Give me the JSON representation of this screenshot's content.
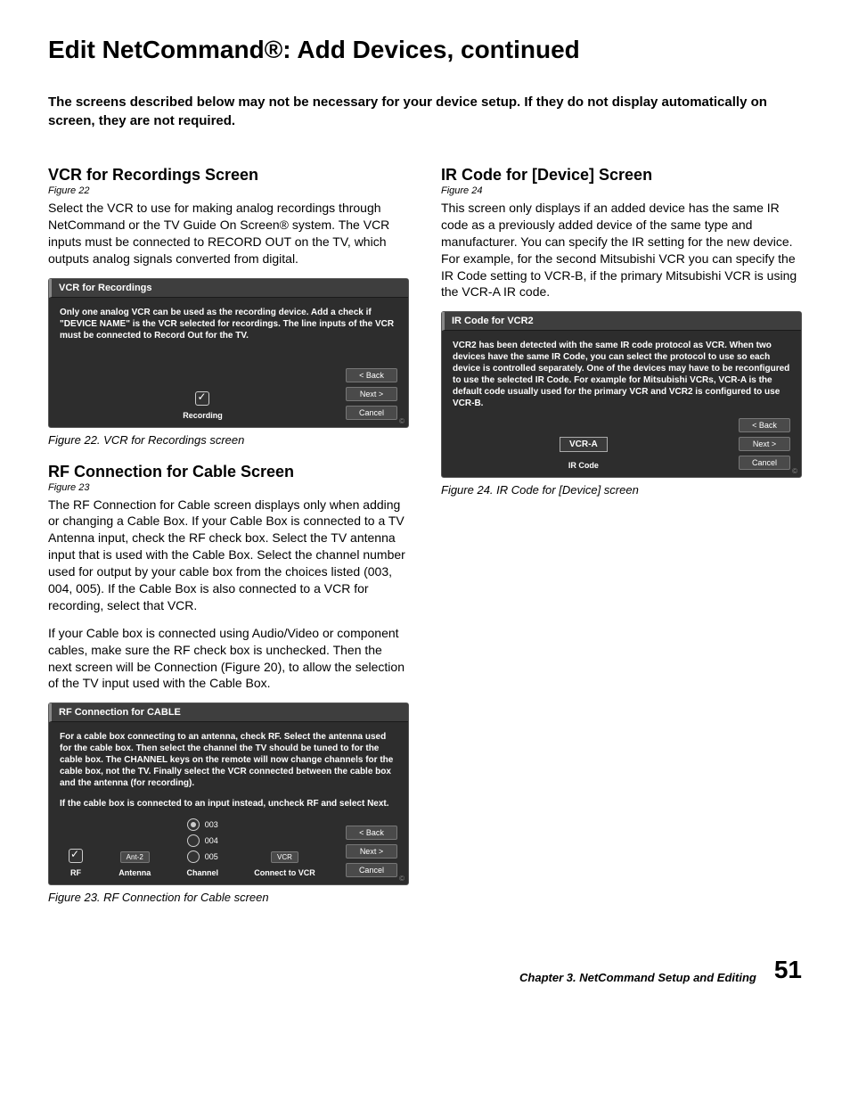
{
  "page_title": "Edit NetCommand®:  Add Devices, continued",
  "note": "The screens described below may not be necessary for your device setup.  If they do not display automatically on screen, they are not required.",
  "left": {
    "vcr": {
      "heading": "VCR for Recordings Screen",
      "figref": "Figure 22",
      "body": "Select the VCR to use for making analog recordings through NetCommand or the TV Guide On Screen® system.  The VCR inputs must be connected to RECORD OUT on the TV, which outputs analog signals converted from digital.",
      "dialog_title": "VCR for Recordings",
      "dialog_text": "Only one analog VCR can be used as the recording device.  Add a check if \"DEVICE NAME\" is the VCR selected for recordings.  The line inputs of the VCR must be connected to Record Out for the TV.",
      "recording_label": "Recording",
      "caption": "Figure 22. VCR for Recordings screen"
    },
    "rf": {
      "heading": "RF Connection for Cable Screen",
      "figref": "Figure 23",
      "body1": "The RF Connection for Cable screen displays only when adding or changing a Cable Box.  If your Cable Box is connected to a TV Antenna input, check the RF check box.  Select the TV antenna input that is used with the Cable Box.  Select the channel number used for output by your cable box from the choices listed (003, 004, 005).  If the Cable Box is also connected to a VCR for recording, select that VCR.",
      "body2": "If your Cable box is connected using Audio/Video or component cables, make sure the RF check box is unchecked.  Then the next screen will be Connection (Figure 20), to allow the selection of the TV input used with the Cable Box.",
      "dialog_title": "RF Connection for CABLE",
      "dialog_text1": "For a cable box connecting to an antenna, check RF. Select the antenna used for the cable box. Then select the channel the TV should be tuned to for the cable box. The CHANNEL keys on the remote will now change channels for the cable box, not the TV.  Finally select the VCR connected between the cable box and the antenna (for recording).",
      "dialog_text2": "If the cable box is connected to an input instead, uncheck RF and select Next.",
      "rf_label": "RF",
      "antenna_value": "Ant-2",
      "antenna_label": "Antenna",
      "ch": [
        "003",
        "004",
        "005"
      ],
      "channel_label": "Channel",
      "vcr_value": "VCR",
      "connect_label": "Connect to VCR",
      "caption": "Figure 23. RF Connection for Cable screen"
    }
  },
  "right": {
    "ir": {
      "heading": "IR Code for [Device] Screen",
      "figref": "Figure 24",
      "body": "This screen only displays if an added device has the same IR code as a previously added device of the same type and manufacturer.  You can specify the IR setting for the new device.  For example, for the second Mitsubishi VCR you can specify the IR Code setting to VCR-B, if the primary Mitsubishi VCR is using the VCR-A IR code.",
      "dialog_title": "IR Code for VCR2",
      "dialog_text": "VCR2 has been detected with the same IR code protocol as VCR.  When two devices have the same IR Code, you can select the protocol to use so each device is controlled separately. One of the devices may have to be reconfigured to use the selected IR Code.  For example for Mitsubishi VCRs, VCR-A is the default code usually used for the primary VCR and VCR2 is configured to use VCR-B.",
      "ir_value": "VCR-A",
      "ir_label": "IR Code",
      "caption": "Figure 24. IR Code for [Device] screen"
    }
  },
  "buttons": {
    "back": "< Back",
    "next": "Next >",
    "cancel": "Cancel"
  },
  "footer": {
    "chapter": "Chapter 3. NetCommand Setup and Editing",
    "page": "51"
  }
}
